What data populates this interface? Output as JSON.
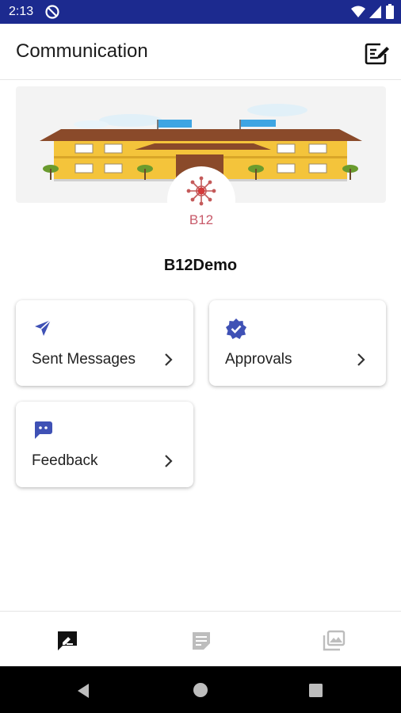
{
  "status_bar": {
    "time": "2:13"
  },
  "app_bar": {
    "title": "Communication"
  },
  "school": {
    "logo_text": "B12",
    "name": "B12Demo"
  },
  "menu": [
    {
      "label": "Sent Messages",
      "icon": "send-icon"
    },
    {
      "label": "Approvals",
      "icon": "verified-badge-icon"
    },
    {
      "label": "Feedback",
      "icon": "feedback-chat-icon"
    }
  ],
  "bottom_nav": [
    {
      "icon": "compose-message-icon",
      "active": true
    },
    {
      "icon": "notes-icon",
      "active": false
    },
    {
      "icon": "gallery-icon",
      "active": false
    }
  ],
  "colors": {
    "status_bar": "#1c2a8f",
    "accent": "#3f51b5",
    "text": "#222222",
    "inactive": "#bdbdbd"
  }
}
